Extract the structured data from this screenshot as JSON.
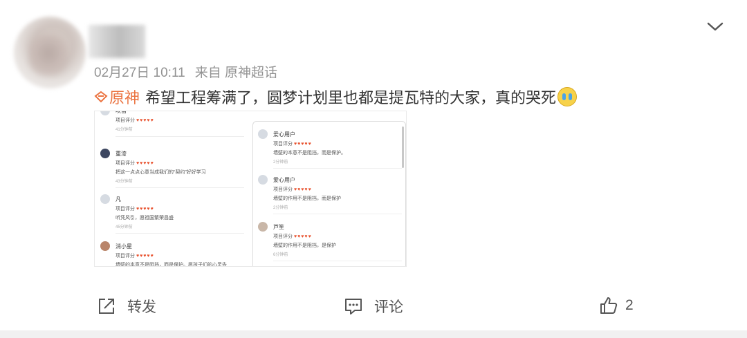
{
  "post": {
    "date": "02月27日 10:11",
    "source": "来自 原神超话",
    "topic": "原神",
    "text": "希望工程筹满了，圆梦计划里也都是提瓦特的大家，真的哭死"
  },
  "embedded_screenshot": {
    "left_comments": [
      {
        "name": "吹笛",
        "rating_label": "项目评分",
        "hearts": "♥♥♥♥♥",
        "text": "",
        "time": "41分钟前"
      },
      {
        "name": "重漆",
        "rating_label": "项目评分",
        "hearts": "♥♥♥♥♥",
        "text": "把这一点点心意当成我们的“契约”好好学习",
        "time": "43分钟前"
      },
      {
        "name": "凡",
        "rating_label": "项目评分",
        "hearts": "♥♥♥♥♥",
        "text": "听凭风引，愿祖国繁荣昌盛",
        "time": "45分钟前"
      },
      {
        "name": "消小星",
        "rating_label": "项目评分",
        "hearts": "♥♥♥♥♥",
        "text": "墙壁的本意不是阻挡，而是保护。愿孩子们的心灵告",
        "time": ""
      }
    ],
    "right_comments": [
      {
        "name": "爱心用户",
        "rating_label": "项目评分",
        "hearts": "♥♥♥♥♥",
        "text": "墙壁的本意不是阻挡，而是保护。",
        "time": "2分钟前"
      },
      {
        "name": "爱心用户",
        "rating_label": "项目评分",
        "hearts": "♥♥♥♥♥",
        "text": "墙壁的作用不是阻挡，而是保护",
        "time": "2分钟前"
      },
      {
        "name": "芦笙",
        "rating_label": "项目评分",
        "hearts": "♥♥♥♥♥",
        "text": "墙壁的作用不是阻挡，是保护",
        "time": "6分钟前"
      }
    ]
  },
  "actions": {
    "repost_label": "转发",
    "comment_label": "评论",
    "like_count": "2"
  },
  "icons": {
    "more": "chevron-down-icon",
    "repost": "share-icon",
    "comment": "comment-icon",
    "like": "thumbs-up-icon",
    "topic": "supertopic-diamond-icon"
  },
  "colors": {
    "topic_accent": "#eb7340",
    "meta_gray": "#939393",
    "heart_red": "#e8502c"
  }
}
